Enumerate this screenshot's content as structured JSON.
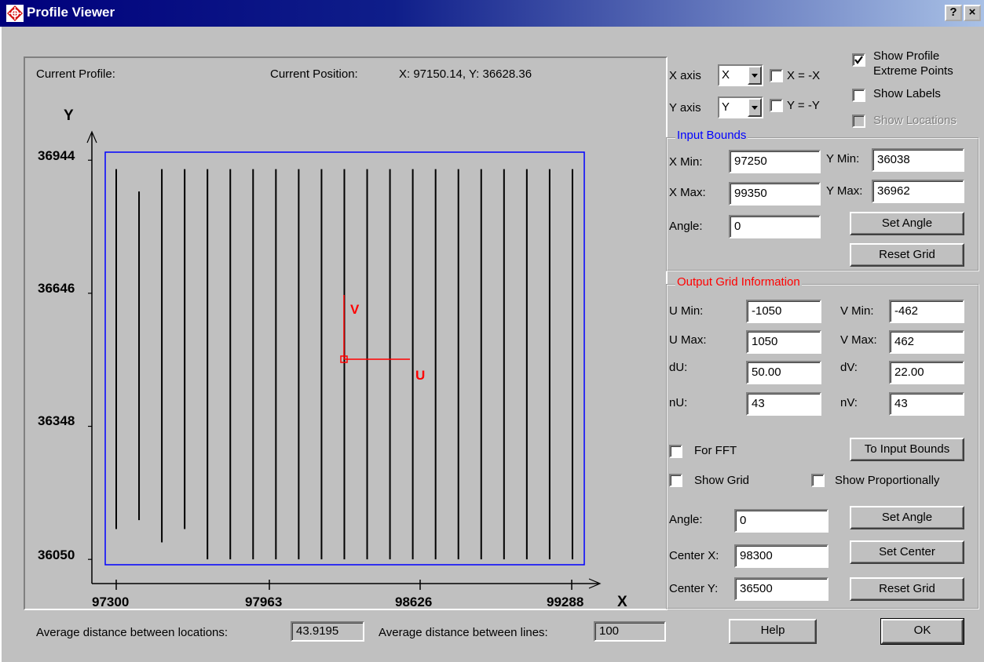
{
  "window": {
    "title": "Profile Viewer",
    "help_icon": "help-question-icon",
    "close_icon": "close-icon",
    "help_glyph": "?",
    "close_glyph": "×"
  },
  "plot": {
    "current_profile_label": "Current Profile:",
    "current_position_label": "Current Position:",
    "current_position_value": "X: 97150.14, Y: 36628.36",
    "x_axis_title": "X",
    "y_axis_title": "Y",
    "u_label": "U",
    "v_label": "V",
    "y_ticks": [
      "36944",
      "36646",
      "36348",
      "36050"
    ],
    "x_ticks": [
      "97300",
      "97963",
      "98626",
      "99288"
    ],
    "colors": {
      "bounds": "#0000ff",
      "uv_axes": "#ff0000",
      "profiles": "#000000"
    }
  },
  "chart_data": {
    "type": "line",
    "title": "",
    "xlabel": "X",
    "ylabel": "Y",
    "xlim": [
      97250,
      99350
    ],
    "ylim": [
      36038,
      36962
    ],
    "x_ticks": [
      97300,
      97963,
      98626,
      99288
    ],
    "y_ticks": [
      36050,
      36348,
      36646,
      36944
    ],
    "bounds_rect": {
      "x_min": 97250,
      "x_max": 99350,
      "y_min": 36038,
      "y_max": 36962
    },
    "uv_origin": {
      "x": 98300,
      "y": 36500
    },
    "profiles": [
      {
        "x": 97250,
        "y_start": 36924,
        "y_end": 36118
      },
      {
        "x": 97350,
        "y_start": 36874,
        "y_end": 36138
      },
      {
        "x": 97450,
        "y_start": 36924,
        "y_end": 36088
      },
      {
        "x": 97550,
        "y_start": 36924,
        "y_end": 36118
      },
      {
        "x": 97650,
        "y_start": 36924,
        "y_end": 36050
      },
      {
        "x": 97750,
        "y_start": 36924,
        "y_end": 36050
      },
      {
        "x": 97850,
        "y_start": 36924,
        "y_end": 36050
      },
      {
        "x": 97950,
        "y_start": 36924,
        "y_end": 36050
      },
      {
        "x": 98050,
        "y_start": 36924,
        "y_end": 36050
      },
      {
        "x": 98150,
        "y_start": 36924,
        "y_end": 36050
      },
      {
        "x": 98250,
        "y_start": 36924,
        "y_end": 36050
      },
      {
        "x": 98350,
        "y_start": 36924,
        "y_end": 36050
      },
      {
        "x": 98450,
        "y_start": 36924,
        "y_end": 36050
      },
      {
        "x": 98550,
        "y_start": 36924,
        "y_end": 36050
      },
      {
        "x": 98650,
        "y_start": 36924,
        "y_end": 36050
      },
      {
        "x": 98750,
        "y_start": 36924,
        "y_end": 36050
      },
      {
        "x": 98850,
        "y_start": 36924,
        "y_end": 36050
      },
      {
        "x": 98950,
        "y_start": 36924,
        "y_end": 36050
      },
      {
        "x": 99050,
        "y_start": 36924,
        "y_end": 36050
      },
      {
        "x": 99150,
        "y_start": 36924,
        "y_end": 36050
      },
      {
        "x": 99250,
        "y_start": 36924,
        "y_end": 36050
      }
    ]
  },
  "axes_options": {
    "x_axis_label": "X axis",
    "x_axis_value": "X",
    "x_neg_label": "X = -X",
    "x_neg_checked": false,
    "y_axis_label": "Y axis",
    "y_axis_value": "Y",
    "y_neg_label": "Y = -Y",
    "y_neg_checked": false,
    "show_extreme_label_1": "Show Profile",
    "show_extreme_label_2": "Extreme Points",
    "show_extreme_checked": true,
    "show_labels_label": "Show Labels",
    "show_labels_checked": false,
    "show_locations_label": "Show Locations",
    "show_locations_checked": false
  },
  "input_bounds": {
    "title": "Input Bounds",
    "title_color": "#0000ff",
    "x_min_label": "X Min:",
    "x_min": "97250",
    "y_min_label": "Y Min:",
    "y_min": "36038",
    "x_max_label": "X Max:",
    "x_max": "99350",
    "y_max_label": "Y Max:",
    "y_max": "36962",
    "angle_label": "Angle:",
    "angle": "0",
    "set_angle": "Set Angle",
    "reset_grid": "Reset Grid"
  },
  "output_grid": {
    "title": "Output Grid Information",
    "title_color": "#ff0000",
    "u_min_label": "U Min:",
    "u_min": "-1050",
    "v_min_label": "V Min:",
    "v_min": "-462",
    "u_max_label": "U Max:",
    "u_max": "1050",
    "v_max_label": "V Max:",
    "v_max": "462",
    "du_label": "dU:",
    "du": "50.00",
    "dv_label": "dV:",
    "dv": "22.00",
    "nu_label": "nU:",
    "nu": "43",
    "nv_label": "nV:",
    "nv": "43",
    "for_fft_label": "For FFT",
    "for_fft_checked": false,
    "to_input_bounds": "To Input Bounds",
    "show_grid_label": "Show Grid",
    "show_grid_checked": false,
    "show_prop_label": "Show Proportionally",
    "show_prop_checked": false,
    "angle_label": "Angle:",
    "angle": "0",
    "set_angle": "Set Angle",
    "center_x_label": "Center X:",
    "center_x": "98300",
    "set_center": "Set Center",
    "center_y_label": "Center Y:",
    "center_y": "36500",
    "reset_grid": "Reset Grid"
  },
  "footer": {
    "avg_loc_label": "Average distance between locations:",
    "avg_loc_value": "43.9195",
    "avg_lines_label": "Average distance between lines:",
    "avg_lines_value": "100",
    "help": "Help",
    "ok": "OK"
  }
}
